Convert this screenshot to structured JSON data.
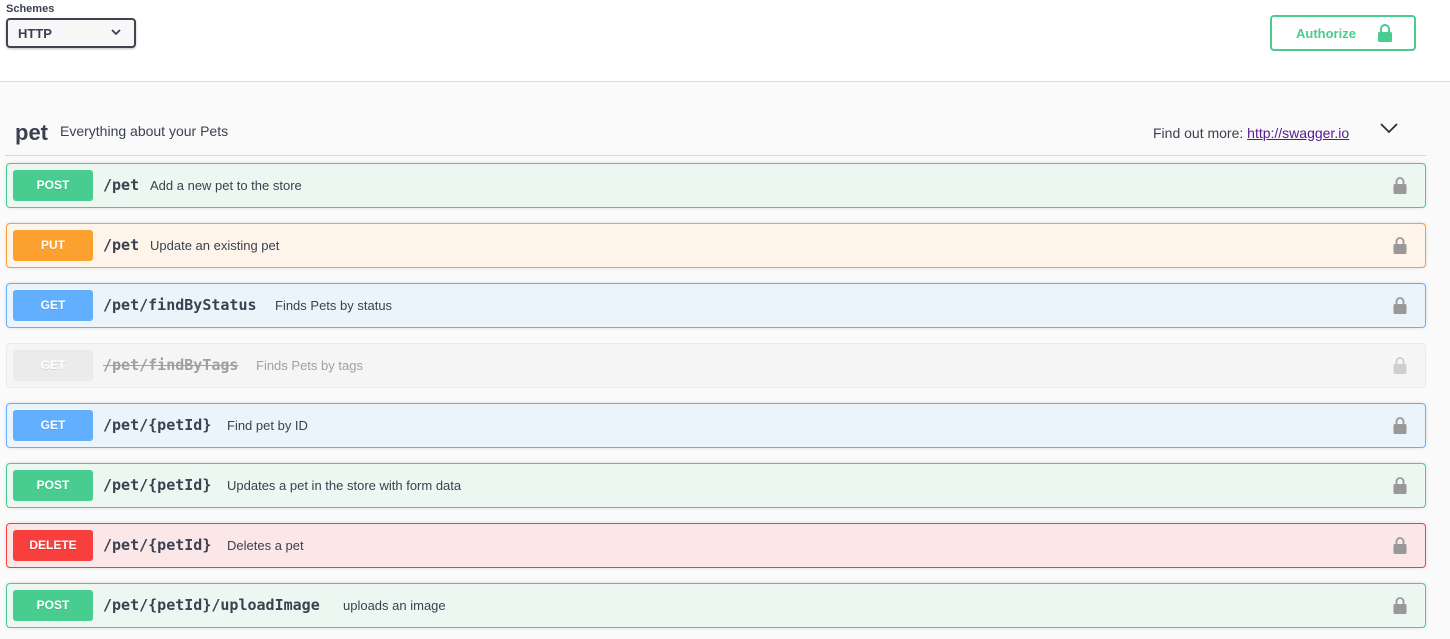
{
  "schemes": {
    "title": "Schemes",
    "selected": "HTTP"
  },
  "authorize": {
    "label": "Authorize"
  },
  "tag": {
    "name": "pet",
    "description": "Everything about your Pets",
    "find_more_label": "Find out more:",
    "find_more_link": "http://swagger.io"
  },
  "operations": [
    {
      "method": "POST",
      "path": "/pet",
      "summary": "Add a new pet to the store"
    },
    {
      "method": "PUT",
      "path": "/pet",
      "summary": "Update an existing pet"
    },
    {
      "method": "GET",
      "path": "/pet/findByStatus",
      "summary": "Finds Pets by status"
    },
    {
      "method": "GET",
      "path": "/pet/findByTags",
      "summary": "Finds Pets by tags",
      "deprecated": true
    },
    {
      "method": "GET",
      "path": "/pet/{petId}",
      "summary": "Find pet by ID"
    },
    {
      "method": "POST",
      "path": "/pet/{petId}",
      "summary": "Updates a pet in the store with form data"
    },
    {
      "method": "DELETE",
      "path": "/pet/{petId}",
      "summary": "Deletes a pet"
    },
    {
      "method": "POST",
      "path": "/pet/{petId}/uploadImage",
      "summary": "uploads an image"
    }
  ],
  "colors": {
    "post": "#49cc90",
    "put": "#fca130",
    "get": "#61affe",
    "delete": "#f93e3e",
    "deprecated": "#ebebeb"
  },
  "icons": {
    "authorize": "lock-icon",
    "operation": "lock-icon",
    "select": "chevron-down-icon",
    "tag_toggle": "chevron-down-icon"
  }
}
